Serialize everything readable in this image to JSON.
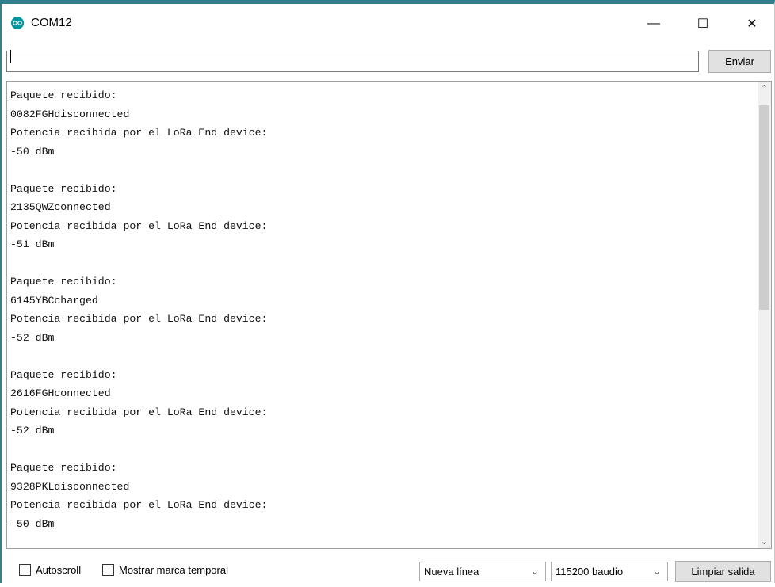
{
  "window": {
    "title": "COM12",
    "icon": "arduino-icon",
    "controls": {
      "minimize": "—",
      "maximize": "☐",
      "close": "✕"
    }
  },
  "send": {
    "input_value": "",
    "button_label": "Enviar"
  },
  "output": {
    "lines": [
      "Paquete recibido:",
      "0082FGHdisconnected",
      "Potencia recibida por el LoRa End device:",
      "-50 dBm",
      "",
      "Paquete recibido:",
      "2135QWZconnected",
      "Potencia recibida por el LoRa End device:",
      "-51 dBm",
      "",
      "Paquete recibido:",
      "6145YBCcharged",
      "Potencia recibida por el LoRa End device:",
      "-52 dBm",
      "",
      "Paquete recibido:",
      "2616FGHconnected",
      "Potencia recibida por el LoRa End device:",
      "-52 dBm",
      "",
      "Paquete recibido:",
      "9328PKLdisconnected",
      "Potencia recibida por el LoRa End device:",
      "-50 dBm"
    ]
  },
  "bottom": {
    "autoscroll_label": "Autoscroll",
    "autoscroll_checked": false,
    "timestamp_label": "Mostrar marca temporal",
    "timestamp_checked": false,
    "line_ending_selected": "Nueva línea",
    "baud_selected": "115200 baudio",
    "clear_label": "Limpiar salida"
  }
}
